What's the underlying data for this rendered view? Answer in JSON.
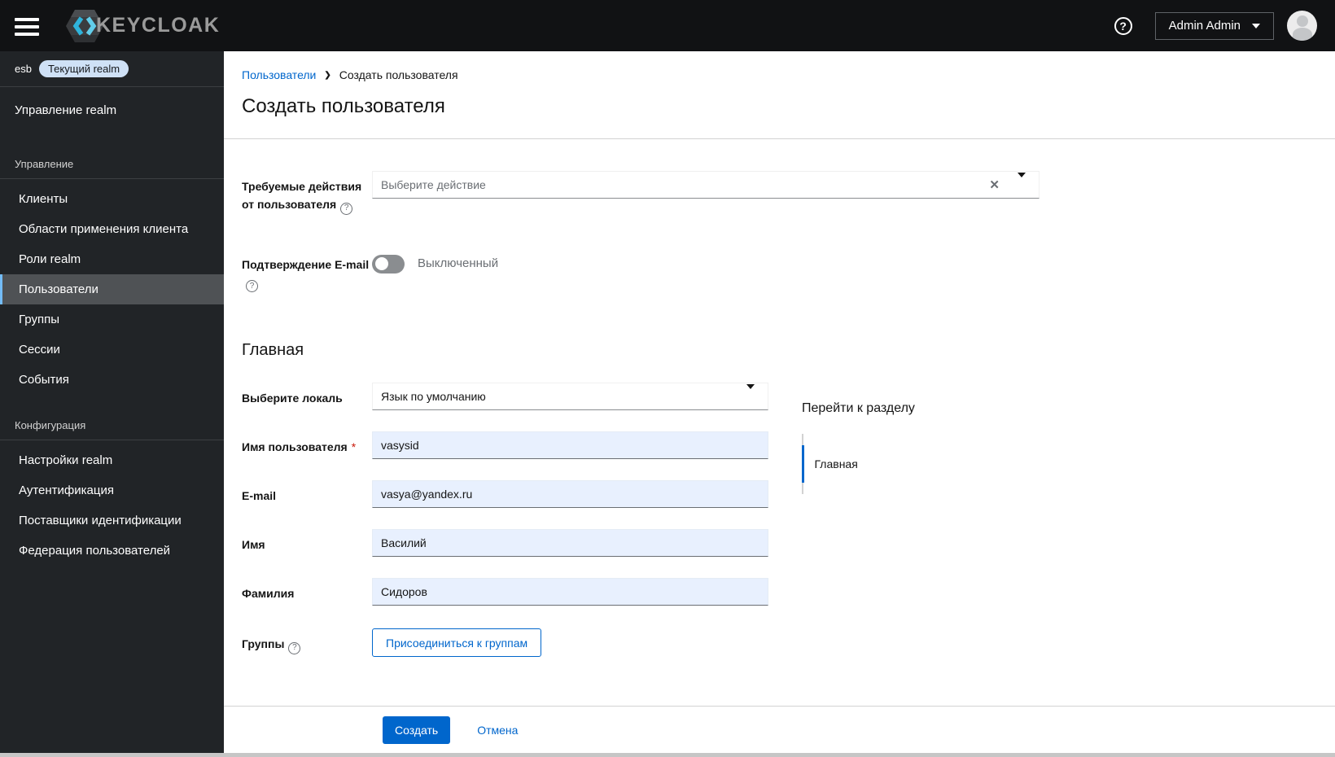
{
  "masthead": {
    "product": "KEYCLOAK",
    "user_menu_label": "Admin Admin",
    "help_glyph": "?"
  },
  "sidebar": {
    "realm_name": "esb",
    "realm_badge": "Текущий realm",
    "realm_management": "Управление realm",
    "sections": [
      {
        "label": "Управление",
        "items": [
          "Клиенты",
          "Области применения клиента",
          "Роли realm",
          "Пользователи",
          "Группы",
          "Сессии",
          "События"
        ],
        "selected": "Пользователи"
      },
      {
        "label": "Конфигурация",
        "items": [
          "Настройки realm",
          "Аутентификация",
          "Поставщики идентификации",
          "Федерация пользователей"
        ]
      }
    ]
  },
  "breadcrumb": {
    "parent": "Пользователи",
    "separator": "❯",
    "current": "Создать пользователя"
  },
  "page": {
    "title": "Создать пользователя"
  },
  "form": {
    "required_actions": {
      "label": "Требуемые действия от пользователя",
      "placeholder": "Выберите действие",
      "clear_glyph": "✕"
    },
    "email_verified": {
      "label": "Подтверждение E-mail",
      "state": "Выключенный",
      "enabled": false
    },
    "section_heading": "Главная",
    "locale": {
      "label": "Выберите локаль",
      "value": "Язык по умолчанию"
    },
    "username": {
      "label": "Имя пользователя",
      "required_mark": "*",
      "value": "vasysid"
    },
    "email": {
      "label": "E-mail",
      "value": "vasya@yandex.ru"
    },
    "first_name": {
      "label": "Имя",
      "value": "Василий"
    },
    "last_name": {
      "label": "Фамилия",
      "value": "Сидоров"
    },
    "groups": {
      "label": "Группы",
      "button": "Присоединиться к группам"
    }
  },
  "jump_panel": {
    "title": "Перейти к разделу",
    "items": [
      "Главная"
    ]
  },
  "actions": {
    "submit": "Создать",
    "cancel": "Отмена"
  },
  "colors": {
    "primary": "#0066cc",
    "masthead_bg": "#111214",
    "sidebar_bg": "#212427",
    "sidebar_selected_bg": "#4f5255",
    "sidebar_selected_border": "#73bcf7",
    "badge_bg": "#cfe1f6",
    "input_filled_bg": "#e8f0fe",
    "required_red": "#c9190b",
    "logo_cyan": "#2fb4dc"
  }
}
